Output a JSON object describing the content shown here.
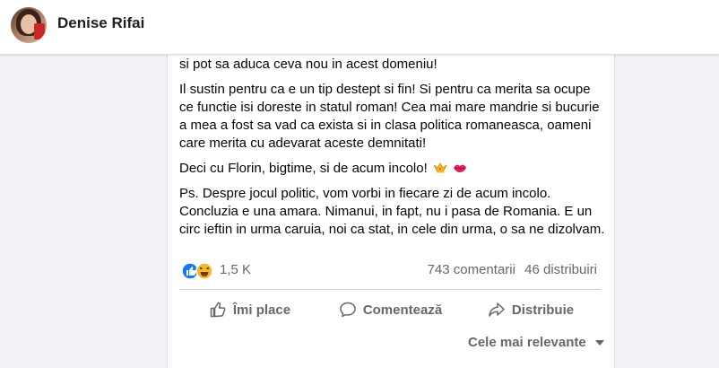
{
  "header": {
    "name": "Denise Rifai"
  },
  "post": {
    "paragraphs": [
      "fost primul - dintr-o serie de multi- care realmente inteleg si stapanesc si pot sa aduca ceva nou in acest domeniu!",
      "Il sustin pentru ca e un tip destept si fin! Si pentru ca merita sa ocupe ce functie isi doreste in statul roman! Cea mai mare mandrie si bucurie a mea a fost sa vad ca exista si in clasa politica romaneasca, oameni care merita cu adevarat aceste demnitati!",
      "Deci cu Florin, bigtime, si de acum incolo!",
      "Ps. Despre jocul politic, vom vorbi in fiecare zi de acum incolo. Concluzia e una amara. Nimanui, in fapt, nu i pasa de Romania. E un circ ieftin in urma caruia, noi ca stat, in cele din urma, o sa ne dizolvam."
    ],
    "emojis": [
      "crown-icon",
      "lips-icon"
    ]
  },
  "reactions": {
    "count": "1,5 K",
    "comments": "743 comentarii",
    "shares": "46 distribuiri",
    "icons": [
      "like-icon",
      "haha-icon"
    ]
  },
  "actions": {
    "like": "Îmi place",
    "comment": "Comentează",
    "share": "Distribuie"
  },
  "sort": {
    "label": "Cele mai relevante"
  },
  "colors": {
    "like_blue": "#1877f2",
    "haha_yellow": "#f7b928",
    "text_secondary": "#65676b"
  }
}
